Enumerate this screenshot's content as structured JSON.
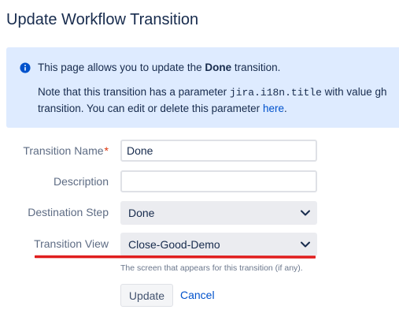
{
  "page": {
    "title": "Update Workflow Transition"
  },
  "info": {
    "icon": "info-icon",
    "line1_prefix": "This page allows you to update the ",
    "line1_bold": "Done",
    "line1_suffix": " transition.",
    "line2_prefix": "Note that this transition has a parameter ",
    "line2_param": "jira.i18n.title",
    "line2_suffix": " with value gh",
    "line3_prefix": "transition. You can edit or delete this parameter ",
    "line3_link": "here",
    "line3_suffix": "."
  },
  "form": {
    "transition_name": {
      "label": "Transition Name",
      "required_marker": "*",
      "value": "Done"
    },
    "description": {
      "label": "Description",
      "value": ""
    },
    "destination_step": {
      "label": "Destination Step",
      "selected": "Done"
    },
    "transition_view": {
      "label": "Transition View",
      "selected": "Close-Good-Demo",
      "help": "The screen that appears for this transition (if any)."
    }
  },
  "actions": {
    "update_label": "Update",
    "cancel_label": "Cancel"
  },
  "colors": {
    "info_background": "#deebff",
    "info_icon": "#0052cc",
    "link": "#0052cc",
    "required": "#de350b",
    "annotation_underline": "#e01e1e"
  }
}
